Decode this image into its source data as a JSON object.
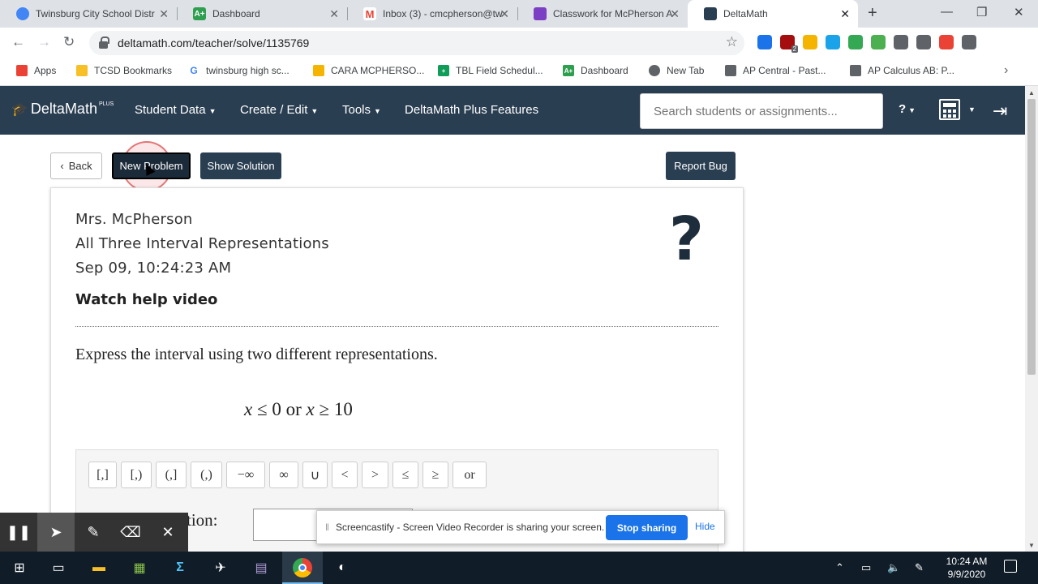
{
  "browser": {
    "tabs": [
      {
        "title": "Twinsburg City School Distr",
        "color": "#4285f4",
        "glyph": ""
      },
      {
        "title": "Dashboard",
        "color": "#2e9e4f",
        "glyph": "A+"
      },
      {
        "title": "Inbox (3) - cmcpherson@tw",
        "color": "#ea4335",
        "glyph": "M"
      },
      {
        "title": "Classwork for McPherson A",
        "color": "#7b3fc4",
        "glyph": ""
      },
      {
        "title": "DeltaMath",
        "color": "#2a3e52",
        "glyph": ""
      }
    ],
    "url": "deltamath.com/teacher/solve/1135769",
    "bookmarks": [
      {
        "label": "Apps",
        "color": "#ea4335"
      },
      {
        "label": "TCSD Bookmarks",
        "color": "#f6c026"
      },
      {
        "label": "twinsburg high sc...",
        "color": "#4285f4",
        "glyph": "G"
      },
      {
        "label": "CARA MCPHERSO...",
        "color": "#f4b400"
      },
      {
        "label": "TBL Field Schedul...",
        "color": "#0f9d58"
      },
      {
        "label": "Dashboard",
        "color": "#2e9e4f",
        "glyph": "A+"
      },
      {
        "label": "New Tab",
        "color": "#5f6368"
      },
      {
        "label": "AP Central - Past...",
        "color": "#5f6368"
      },
      {
        "label": "AP Calculus AB: P...",
        "color": "#5f6368"
      }
    ],
    "extensions": [
      {
        "icon": "shield-extension-icon",
        "color": "#1a73e8"
      },
      {
        "icon": "badge-extension-icon",
        "color": "#a50e0e",
        "badge": "2"
      },
      {
        "icon": "thumbs-up-extension-icon",
        "color": "#f4b400"
      },
      {
        "icon": "diamond-extension-icon",
        "color": "#1aa3e8"
      },
      {
        "icon": "screencastify-extension-icon",
        "color": "#34a853"
      },
      {
        "icon": "download-extension-icon",
        "color": "#4caf50"
      },
      {
        "icon": "mute-extension-icon",
        "color": "#5f6368"
      },
      {
        "icon": "pin-extension-icon",
        "color": "#5f6368"
      },
      {
        "icon": "record-extension-icon",
        "color": "#ea4335"
      },
      {
        "icon": "puzzle-extension-icon",
        "color": "#5f6368"
      }
    ]
  },
  "nav": {
    "logo": "DeltaMath",
    "logo_sup": "PLUS",
    "menus": [
      "Student Data",
      "Create / Edit",
      "Tools",
      "DeltaMath Plus Features"
    ],
    "search_placeholder": "Search students or assignments...",
    "help": "?"
  },
  "actions": {
    "back": "Back",
    "new_problem": "New Problem",
    "show_solution": "Show Solution",
    "report_bug": "Report Bug"
  },
  "problem": {
    "teacher": "Mrs. McPherson",
    "skill": "All Three Interval Representations",
    "timestamp": "Sep 09, 10:24:23 AM",
    "help_video": "Watch help video",
    "help_icon": "?",
    "prompt": "Express the interval using two different representations.",
    "expression": {
      "v1": "x",
      "op1": "≤",
      "n1": "0",
      "conj": "or",
      "v2": "x",
      "op2": "≥",
      "n2": "10"
    },
    "palette": [
      "[,]",
      "[,)",
      "(,]",
      "(,)",
      "−∞",
      "∞",
      "∪",
      "<",
      ">",
      "≤",
      "≥",
      "or"
    ],
    "answer_label": "tion:"
  },
  "share": {
    "message": "Screencastify - Screen Video Recorder is sharing your screen.",
    "stop": "Stop sharing",
    "hide": "Hide"
  },
  "taskbar": {
    "time": "10:24 AM",
    "date": "9/9/2020"
  },
  "colors": {
    "nav_bg": "#2a3e52",
    "button_dark": "#2a3e52",
    "share_blue": "#1a73e8",
    "taskbar_bg": "#101c28"
  }
}
